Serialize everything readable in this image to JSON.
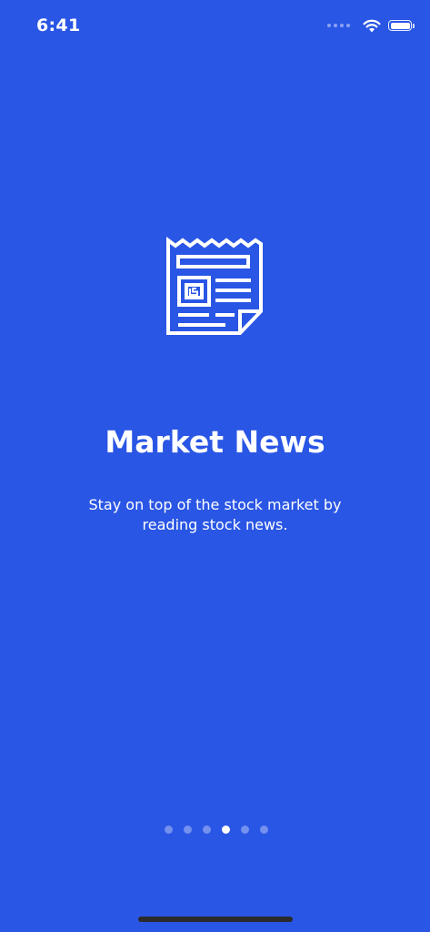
{
  "status_bar": {
    "time": "6:41",
    "icons": [
      "cellular-signal-icon",
      "wifi-icon",
      "battery-icon"
    ]
  },
  "onboarding": {
    "icon": "newspaper-icon",
    "title": "Market News",
    "description": "Stay on top of the stock market by reading stock news."
  },
  "pagination": {
    "total_pages": 6,
    "current_page": 4
  },
  "colors": {
    "background": "#2a56e5",
    "text": "#ffffff",
    "inactive_dot": "rgba(255,255,255,0.35)",
    "home_indicator": "#2b2b2b"
  }
}
